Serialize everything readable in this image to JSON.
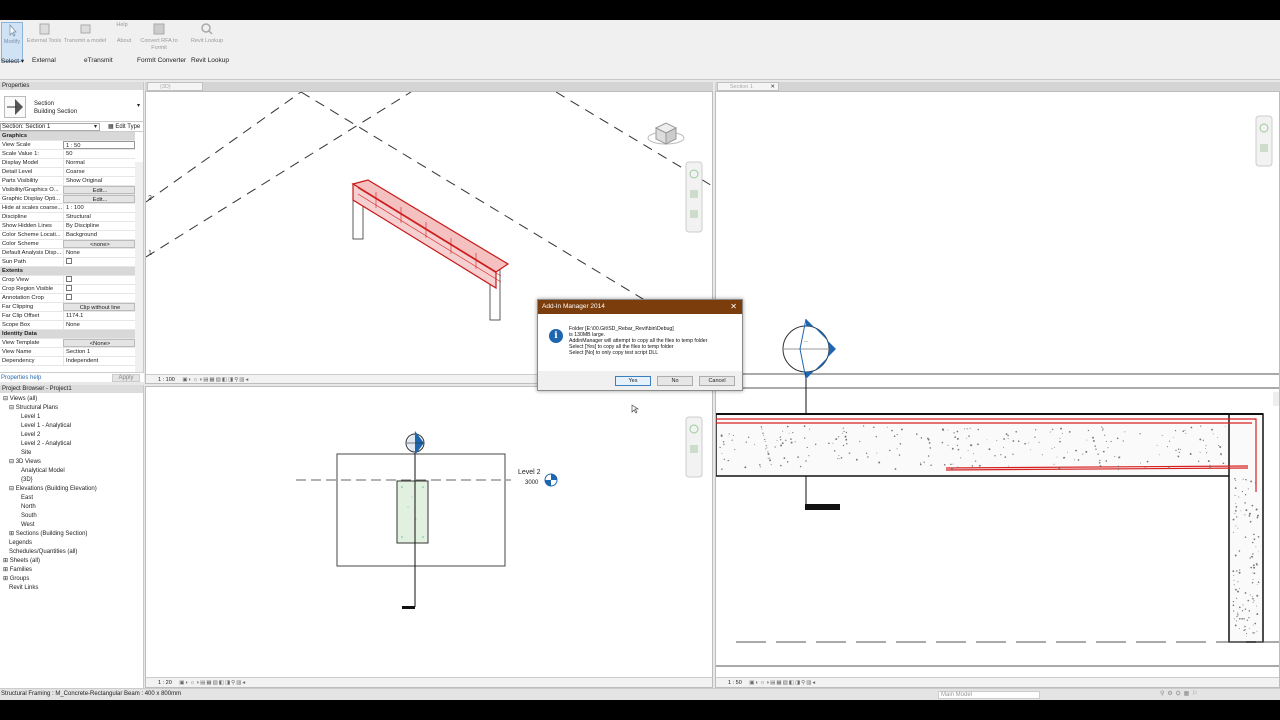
{
  "ribbon": {
    "buttons": [
      {
        "label": "Modify",
        "active": true
      },
      {
        "label": "External Tools"
      },
      {
        "label": "Transmit a model"
      },
      {
        "label": "Help"
      },
      {
        "label": "About"
      },
      {
        "label": "Convert RFA to Formit"
      },
      {
        "label": "Revit Lookup"
      }
    ],
    "groups": [
      "Select ▾",
      "External",
      "eTransmit",
      "FormIt Converter",
      "Revit Lookup"
    ]
  },
  "tabs": {
    "left": "{3D}",
    "right": "Section 1",
    "close": "✕"
  },
  "properties": {
    "title": "Properties",
    "type_name": "Section",
    "type_sub": "Building Section",
    "selector": "Section: Section 1",
    "edit_type": "Edit Type",
    "rows": [
      {
        "k": "Graphics",
        "sec": true
      },
      {
        "k": "View Scale",
        "v": "1 : 50",
        "style": "box"
      },
      {
        "k": "Scale Value    1:",
        "v": "50"
      },
      {
        "k": "Display Model",
        "v": "Normal"
      },
      {
        "k": "Detail Level",
        "v": "Coarse"
      },
      {
        "k": "Parts Visibility",
        "v": "Show Original"
      },
      {
        "k": "Visibility/Graphics O...",
        "v": "Edit...",
        "style": "btn"
      },
      {
        "k": "Graphic Display Opti...",
        "v": "Edit...",
        "style": "btn"
      },
      {
        "k": "Hide at scales coarse...",
        "v": "1 : 100"
      },
      {
        "k": "Discipline",
        "v": "Structural"
      },
      {
        "k": "Show Hidden Lines",
        "v": "By Discipline"
      },
      {
        "k": "Color Scheme Locati...",
        "v": "Background"
      },
      {
        "k": "Color Scheme",
        "v": "<none>",
        "style": "btn"
      },
      {
        "k": "Default Analysis Disp...",
        "v": "None"
      },
      {
        "k": "Sun Path",
        "v": "",
        "style": "chk"
      },
      {
        "k": "Extents",
        "sec": true
      },
      {
        "k": "Crop View",
        "v": "",
        "style": "chk"
      },
      {
        "k": "Crop Region Visible",
        "v": "",
        "style": "chk"
      },
      {
        "k": "Annotation Crop",
        "v": "",
        "style": "chk"
      },
      {
        "k": "Far Clipping",
        "v": "Clip without line",
        "style": "btn"
      },
      {
        "k": "Far Clip Offset",
        "v": "1174.1"
      },
      {
        "k": "Scope Box",
        "v": "None"
      },
      {
        "k": "Identity Data",
        "sec": true
      },
      {
        "k": "View Template",
        "v": "<None>",
        "style": "btn"
      },
      {
        "k": "View Name",
        "v": "Section 1"
      },
      {
        "k": "Dependency",
        "v": "Independent"
      }
    ],
    "help_link": "Properties help",
    "apply": "Apply"
  },
  "browser": {
    "title": "Project Browser - Project1",
    "nodes": [
      {
        "t": "⊟  Views (all)",
        "d": 0
      },
      {
        "t": "⊟  Structural Plans",
        "d": 1
      },
      {
        "t": "Level 1",
        "d": 3
      },
      {
        "t": "Level 1 - Analytical",
        "d": 3
      },
      {
        "t": "Level 2",
        "d": 3
      },
      {
        "t": "Level 2 - Analytical",
        "d": 3
      },
      {
        "t": "Site",
        "d": 3
      },
      {
        "t": "⊟  3D Views",
        "d": 1
      },
      {
        "t": "Analytical Model",
        "d": 3
      },
      {
        "t": "{3D}",
        "d": 3
      },
      {
        "t": "⊟  Elevations (Building Elevation)",
        "d": 1
      },
      {
        "t": "East",
        "d": 3
      },
      {
        "t": "North",
        "d": 3
      },
      {
        "t": "South",
        "d": 3
      },
      {
        "t": "West",
        "d": 3
      },
      {
        "t": "⊞  Sections (Building Section)",
        "d": 1
      },
      {
        "t": "Legends",
        "d": 1
      },
      {
        "t": "Schedules/Quantities (all)",
        "d": 1
      },
      {
        "t": "⊞  Sheets (all)",
        "d": 0
      },
      {
        "t": "⊞  Families",
        "d": 0
      },
      {
        "t": "⊞  Groups",
        "d": 0
      },
      {
        "t": "Revit Links",
        "d": 1
      }
    ]
  },
  "views": {
    "view3d_scale": "1 : 100",
    "plan_scale": "1 : 20",
    "section_scale": "1 : 50",
    "level_label": "Level 2",
    "level_value": "3000"
  },
  "dialog": {
    "title": "Add-In Manager 2014",
    "close": "✕",
    "icon": "i",
    "lines": [
      "Folder [E:\\00.Git\\SD_Rebar_Revit\\bin\\Debug]",
      "is 130MB large.",
      "AddinManager will attempt to copy all the files to temp folder",
      "Select [Yes] to copy all the files to temp folder",
      "Select [No] to only copy test script DLL"
    ],
    "yes": "Yes",
    "no": "No",
    "cancel": "Cancel"
  },
  "status": {
    "text": "Structural Framing : M_Concrete-Rectangular Beam : 400 x 800mm",
    "model": "Main Model"
  },
  "colors": {
    "dialog_title": "#7a3d0b",
    "rebar": "#d62020",
    "section_head": "#1f66b0"
  }
}
